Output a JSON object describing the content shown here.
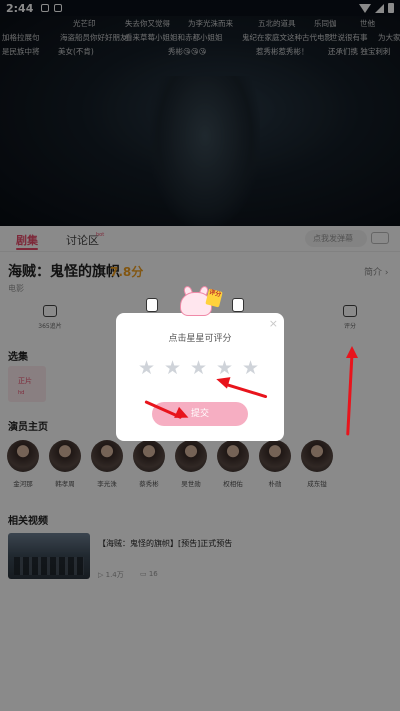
{
  "status_bar": {
    "time": "2:44"
  },
  "danmu": [
    "光芒印",
    "失去你又觉得",
    "为李光洙而来",
    "五北的道具",
    "乐同伽",
    "世他",
    "加格拉展句",
    "海盗船员你好好朋友",
    "看来草莓小姐姐和赤都小姐姐",
    "鬼纪在家庭文这种古代电影",
    "世说很有事",
    "为大家",
    "是民族中将",
    "美女(不肯)",
    "秀彬😘😘😘",
    "惹秀彬惹秀彬！",
    "还承们携 独宝刺刺"
  ],
  "tabs": {
    "details": "剧集",
    "discussion": "讨论区",
    "discussion_badge": "hot",
    "danmu_placeholder": "点我发弹幕"
  },
  "show": {
    "title": "海贼：鬼怪的旗帜",
    "score": "7.8分",
    "type": "电影",
    "intro": "简介 ›"
  },
  "actions": {
    "follow": "365追片",
    "comment": "评分"
  },
  "episodes": {
    "section_title": "选集",
    "card_label": "正片",
    "card_sub": "hd"
  },
  "cast": {
    "section_title": "演员主页",
    "members": [
      "金河那",
      "韩孝周",
      "李光洙",
      "蔡秀彬",
      "吴世勋",
      "权相佑",
      "朴勋",
      "成东镒"
    ]
  },
  "related": {
    "section_title": "相关视频",
    "title": "【海贼：鬼怪的旗帜】[预告]正式预告",
    "plays": "1.4万",
    "comments": "16"
  },
  "rating_dialog": {
    "prompt": "点击星星可评分",
    "stars": [
      "★",
      "★",
      "★",
      "★",
      "★"
    ],
    "submit_label": "提交",
    "close_glyph": "×",
    "mascot_sign": "评分"
  },
  "colors": {
    "accent": "#e84a6a",
    "submit": "#f6aec2",
    "arrows": "#e8141c",
    "star_empty": "#cfd3d9",
    "score": "#f0a020"
  }
}
